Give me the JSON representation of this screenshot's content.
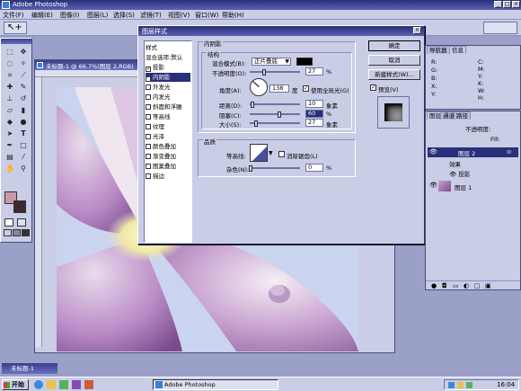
{
  "app": {
    "title": "Adobe Photoshop"
  },
  "menu": [
    "文件(F)",
    "编辑(E)",
    "图像(I)",
    "图层(L)",
    "选择(S)",
    "滤镜(T)",
    "视图(V)",
    "窗口(W)",
    "帮助(H)"
  ],
  "document": {
    "title": "未标题-1 @ 66.7%(图层 2,RGB)",
    "minimized_title": "未标题-1"
  },
  "dialog": {
    "title": "图层样式",
    "styles": [
      {
        "label": "样式",
        "checked": null,
        "selected": false
      },
      {
        "label": "混合选项:默认",
        "checked": null,
        "selected": false
      },
      {
        "label": "投影",
        "checked": true,
        "selected": false
      },
      {
        "label": "内阴影",
        "checked": true,
        "selected": true
      },
      {
        "label": "外发光",
        "checked": false,
        "selected": false
      },
      {
        "label": "内发光",
        "checked": false,
        "selected": false
      },
      {
        "label": "斜面和浮雕",
        "checked": false,
        "selected": false
      },
      {
        "label": "等高线",
        "checked": false,
        "selected": false
      },
      {
        "label": "纹理",
        "checked": false,
        "selected": false
      },
      {
        "label": "光泽",
        "checked": false,
        "selected": false
      },
      {
        "label": "颜色叠加",
        "checked": false,
        "selected": false
      },
      {
        "label": "渐变叠加",
        "checked": false,
        "selected": false
      },
      {
        "label": "图案叠加",
        "checked": false,
        "selected": false
      },
      {
        "label": "描边",
        "checked": false,
        "selected": false
      }
    ],
    "section_title": "内阴影",
    "structure_title": "结构",
    "blend_mode_label": "混合模式(B):",
    "blend_mode_value": "正片叠底",
    "shadow_color": "#000000",
    "opacity_label": "不透明度(O):",
    "opacity_value": "27",
    "opacity_pct": 27,
    "percent_sign": "%",
    "angle_label": "角度(A):",
    "angle_value": "138",
    "angle_unit": "度",
    "global_light_label": "使用全局光(G)",
    "global_light_checked": true,
    "distance_label": "距离(D):",
    "distance_value": "10",
    "distance_pct": 4,
    "choke_label": "阻塞(C):",
    "choke_value": "60",
    "choke_pct": 60,
    "size_label": "大小(S):",
    "size_value": "27",
    "size_pct": 11,
    "pixel_unit": "象素",
    "quality_title": "品质",
    "contour_label": "等高线:",
    "antialias_label": "消除锯齿(L)",
    "antialias_checked": false,
    "noise_label": "杂色(N):",
    "noise_value": "0",
    "noise_pct": 0,
    "ok_label": "确定",
    "cancel_label": "取消",
    "new_style_label": "新建样式(W)...",
    "preview_label": "预览(V)",
    "preview_checked": true
  },
  "navigator": {
    "tabs": [
      "导航器",
      "信息"
    ],
    "labels_left": [
      "R:",
      "G:",
      "B:",
      "X:",
      "Y:"
    ],
    "labels_right": [
      "C:",
      "M:",
      "Y:",
      "K:",
      "W:",
      "H:"
    ]
  },
  "layers": {
    "tabs": [
      "图层",
      "通道",
      "路径"
    ],
    "opacity_label": "不透明度:",
    "fill_label": "Fill:",
    "items": [
      {
        "name": "图层 2",
        "selected": true
      },
      {
        "name": "效果",
        "selected": false
      },
      {
        "name": "投影",
        "selected": false
      },
      {
        "name": "图层 1",
        "selected": false
      }
    ]
  },
  "taskbar": {
    "start_label": "开始",
    "active_app": "Adobe Photoshop",
    "clock": "16:04"
  }
}
